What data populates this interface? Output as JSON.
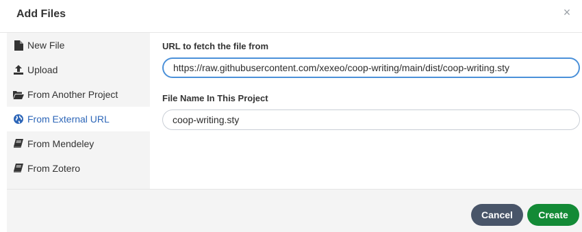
{
  "dialog": {
    "title": "Add Files",
    "close_symbol": "×"
  },
  "sidebar": {
    "items": [
      {
        "label": "New File",
        "icon": "file-icon"
      },
      {
        "label": "Upload",
        "icon": "upload-icon"
      },
      {
        "label": "From Another Project",
        "icon": "folder-open-icon"
      },
      {
        "label": "From External URL",
        "icon": "globe-icon",
        "active": true
      },
      {
        "label": "From Mendeley",
        "icon": "book-icon"
      },
      {
        "label": "From Zotero",
        "icon": "book-icon"
      }
    ]
  },
  "form": {
    "url_label": "URL to fetch the file from",
    "url_value": "https://raw.githubusercontent.com/xexeo/coop-writing/main/dist/coop-writing.sty",
    "filename_label": "File Name In This Project",
    "filename_value": "coop-writing.sty"
  },
  "footer": {
    "cancel_label": "Cancel",
    "create_label": "Create"
  },
  "colors": {
    "active_blue": "#2d66b8",
    "cancel_bg": "#495569",
    "create_bg": "#138a36",
    "focus_border": "#4a90d9"
  }
}
